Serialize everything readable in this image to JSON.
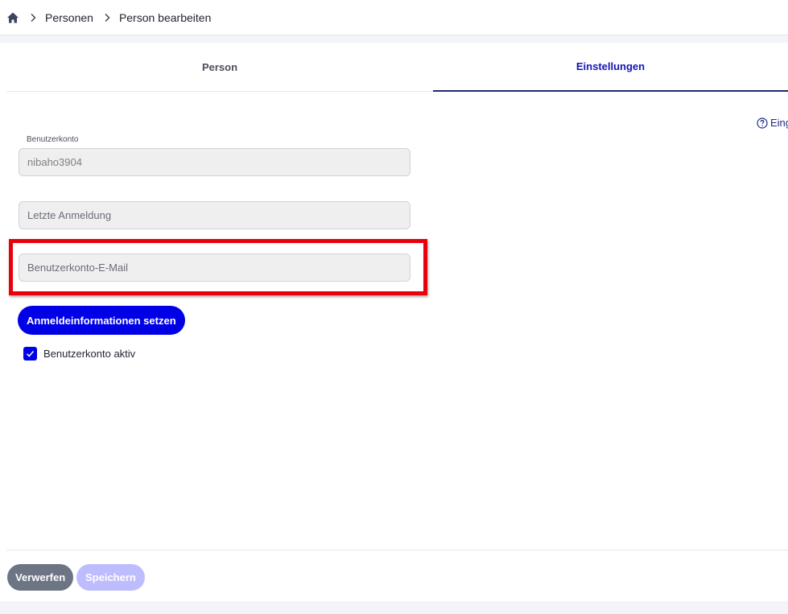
{
  "breadcrumb": {
    "items": [
      "Personen",
      "Person bearbeiten"
    ]
  },
  "tabs": [
    {
      "label": "Person",
      "active": false
    },
    {
      "label": "Einstellungen",
      "active": true
    }
  ],
  "help": {
    "label": "Eing"
  },
  "form": {
    "account_label": "Benutzerkonto",
    "account_value": "nibaho3904",
    "last_login_placeholder": "Letzte Anmeldung",
    "email_placeholder": "Benutzerkonto-E-Mail",
    "set_credentials_label": "Anmeldeinformationen setzen",
    "account_active_label": "Benutzerkonto aktiv",
    "account_active_checked": true
  },
  "footer": {
    "discard_label": "Verwerfen",
    "save_label": "Speichern"
  },
  "colors": {
    "primary": "#0000e6",
    "highlight": "#e8000b",
    "active_tab": "#1414b8"
  },
  "icons": [
    "home-icon",
    "chevron-right-icon",
    "help-circle-icon",
    "checkmark-icon"
  ]
}
